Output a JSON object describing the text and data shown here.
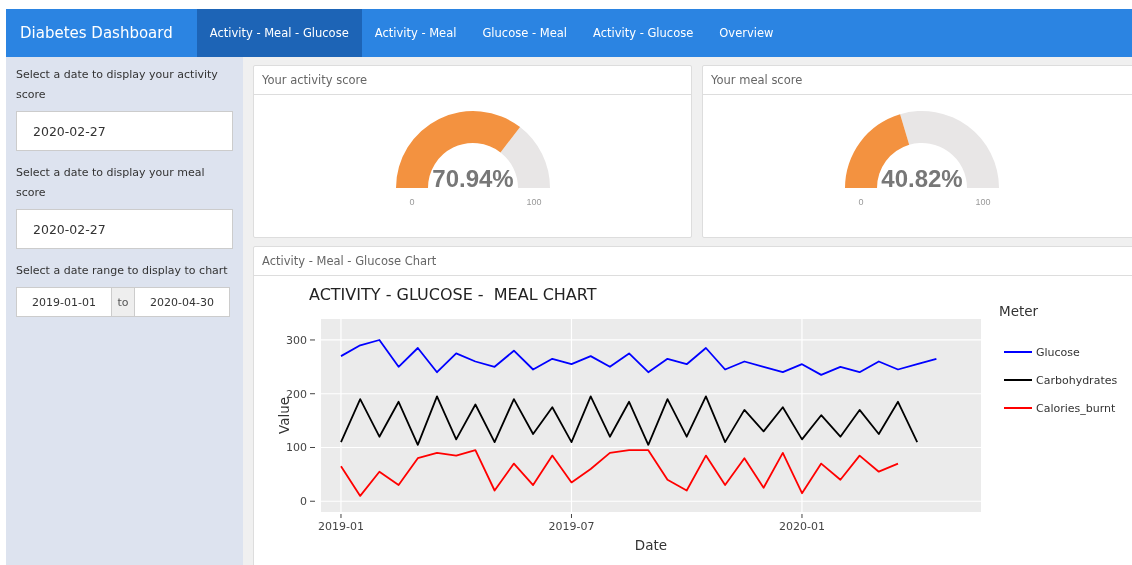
{
  "navbar": {
    "brand": "Diabetes Dashboard",
    "tabs": [
      {
        "label": "Activity - Meal - Glucose",
        "selected": true
      },
      {
        "label": "Activity - Meal",
        "selected": false
      },
      {
        "label": "Glucose - Meal",
        "selected": false
      },
      {
        "label": "Activity - Glucose",
        "selected": false
      },
      {
        "label": "Overview",
        "selected": false
      }
    ]
  },
  "sidebar": {
    "date_inputs": [
      {
        "label": "Select a date to display your activity score",
        "value": "2020-02-27"
      },
      {
        "label": "Select a date to display your meal score",
        "value": "2020-02-27"
      }
    ],
    "date_range": {
      "label": "Select a date range to display to chart",
      "start": "2019-01-01",
      "separator": "to",
      "end": "2020-04-30"
    }
  },
  "score_cards": [
    {
      "title": "Your activity score",
      "value": "70.94%",
      "min": "0",
      "max": "100"
    },
    {
      "title": "Your meal score",
      "value": "40.82%",
      "min": "0",
      "max": "100"
    }
  ],
  "chart_card": {
    "title": "Activity - Meal - Glucose Chart",
    "legend_title": "Meter",
    "chart_data": {
      "type": "line",
      "title": "ACTIVITY - GLUCOSE -  MEAL CHART",
      "xlabel": "Date",
      "ylabel": "Value",
      "categories": [
        "2019-01",
        null,
        null,
        null,
        null,
        null,
        null,
        null,
        null,
        null,
        null,
        null,
        "2019-07",
        null,
        null,
        null,
        null,
        null,
        null,
        null,
        null,
        null,
        null,
        null,
        "2020-01",
        null,
        null,
        null,
        null,
        null,
        null,
        null
      ],
      "series": [
        {
          "name": "Glucose",
          "color": "#0000ff",
          "values": [
            270,
            290,
            300,
            250,
            285,
            240,
            275,
            260,
            250,
            280,
            245,
            265,
            255,
            270,
            250,
            275,
            240,
            265,
            255,
            285,
            245,
            260,
            250,
            240,
            255,
            235,
            250,
            240,
            260,
            245,
            255,
            265
          ]
        },
        {
          "name": "Carbohydrates",
          "color": "#000000",
          "values": [
            110,
            190,
            120,
            185,
            105,
            195,
            115,
            180,
            110,
            190,
            125,
            175,
            110,
            195,
            120,
            185,
            105,
            190,
            120,
            195,
            110,
            170,
            130,
            175,
            115,
            160,
            120,
            170,
            125,
            185,
            110,
            null
          ]
        },
        {
          "name": "Calories_burnt",
          "color": "#ff0000",
          "values": [
            65,
            10,
            55,
            30,
            80,
            90,
            85,
            95,
            20,
            70,
            30,
            85,
            35,
            60,
            90,
            95,
            95,
            40,
            20,
            85,
            30,
            80,
            25,
            90,
            15,
            70,
            40,
            85,
            55,
            70,
            null,
            null
          ]
        }
      ],
      "ylim": [
        -20,
        339
      ],
      "grid": true,
      "legend": "right",
      "yticks": [
        0,
        100,
        200,
        300
      ]
    }
  }
}
